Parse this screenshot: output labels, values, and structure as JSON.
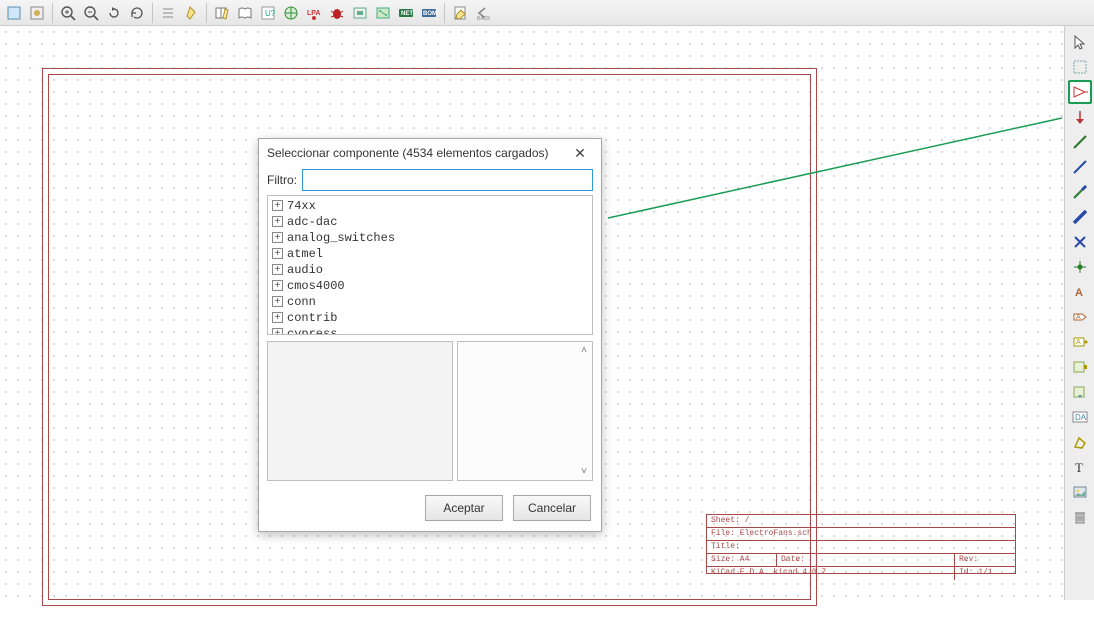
{
  "top_toolbar_icons": [
    "sheet-icon",
    "view-icon",
    "zoom-in-icon",
    "zoom-out-icon",
    "redo-icon",
    "refresh-icon",
    "sep",
    "list-icon",
    "note-icon",
    "sep",
    "library-icon",
    "book-icon",
    "annotate-icon",
    "globe-icon",
    "lpa-icon",
    "bug-icon",
    "cvpcb-icon",
    "pcbnew-icon",
    "net-icon",
    "bom-icon",
    "sep",
    "edit-icon",
    "back-icon"
  ],
  "right_toolbar": [
    {
      "name": "cursor-icon",
      "hl": false
    },
    {
      "name": "select-icon",
      "hl": false
    },
    {
      "name": "place-component-icon",
      "hl": true
    },
    {
      "name": "power-port-icon",
      "hl": false
    },
    {
      "name": "wire-icon",
      "hl": false
    },
    {
      "name": "line-icon",
      "hl": false
    },
    {
      "name": "bus-entry-icon",
      "hl": false
    },
    {
      "name": "bus-icon",
      "hl": false
    },
    {
      "name": "no-connect-icon",
      "hl": false
    },
    {
      "name": "junction-icon",
      "hl": false
    },
    {
      "name": "label-icon",
      "hl": false
    },
    {
      "name": "global-label-icon",
      "hl": false
    },
    {
      "name": "hier-label-icon",
      "hl": false
    },
    {
      "name": "sheet-pin-icon",
      "hl": false
    },
    {
      "name": "import-pin-icon",
      "hl": false
    },
    {
      "name": "da-icon",
      "hl": false
    },
    {
      "name": "poly-icon",
      "hl": false
    },
    {
      "name": "text-icon",
      "hl": false
    },
    {
      "name": "image-icon",
      "hl": false
    },
    {
      "name": "delete-icon",
      "hl": false
    }
  ],
  "dialog": {
    "title": "Seleccionar componente (4534 elementos cargados)",
    "filter_label": "Filtro:",
    "filter_value": "",
    "items": [
      "74xx",
      "adc-dac",
      "analog_switches",
      "atmel",
      "audio",
      "cmos4000",
      "conn",
      "contrib",
      "cypress"
    ],
    "accept_label": "Aceptar",
    "cancel_label": "Cancelar"
  },
  "titleblock": {
    "r1": "Sheet: /",
    "r2": "File: ElectroFans.sch",
    "r3a": "Title:",
    "r4a": "Size: A4",
    "r4b": "Date:",
    "r4c": "Rev:",
    "r5a": "KiCad E.D.A.  kicad 4.0.7",
    "r5b": "Id: 1/1"
  }
}
